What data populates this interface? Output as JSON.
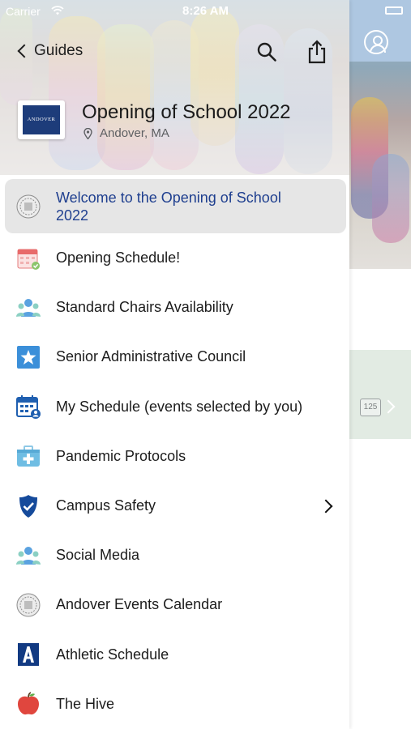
{
  "status_bar": {
    "carrier": "Carrier",
    "time": "8:26 AM"
  },
  "nav": {
    "back_label": "Guides"
  },
  "guide": {
    "logo_text": "ANDOVER",
    "title": "Opening of School 2022",
    "location": "Andover, MA"
  },
  "background": {
    "badge_text": "125"
  },
  "menu": [
    {
      "label": "Welcome to the Opening of School 2022",
      "icon": "seal-icon",
      "active": true
    },
    {
      "label": "Opening Schedule!",
      "icon": "calendar-check-icon"
    },
    {
      "label": "Standard Chairs Availability",
      "icon": "group-icon"
    },
    {
      "label": "Senior Administrative Council",
      "icon": "star-icon"
    },
    {
      "label": "My Schedule (events selected by you)",
      "icon": "calendar-user-icon"
    },
    {
      "label": "Pandemic Protocols",
      "icon": "first-aid-kit-icon"
    },
    {
      "label": "Campus Safety",
      "icon": "police-badge-icon",
      "has_submenu": true
    },
    {
      "label": "Social Media",
      "icon": "group-icon"
    },
    {
      "label": "Andover Events Calendar",
      "icon": "seal-icon"
    },
    {
      "label": "Athletic Schedule",
      "icon": "letter-a-icon"
    },
    {
      "label": "The Hive",
      "icon": "apple-icon"
    }
  ],
  "colors": {
    "active_label": "#1f3f8f",
    "active_bg": "#e6e6e6",
    "brand_navy": "#1d3c7a"
  }
}
